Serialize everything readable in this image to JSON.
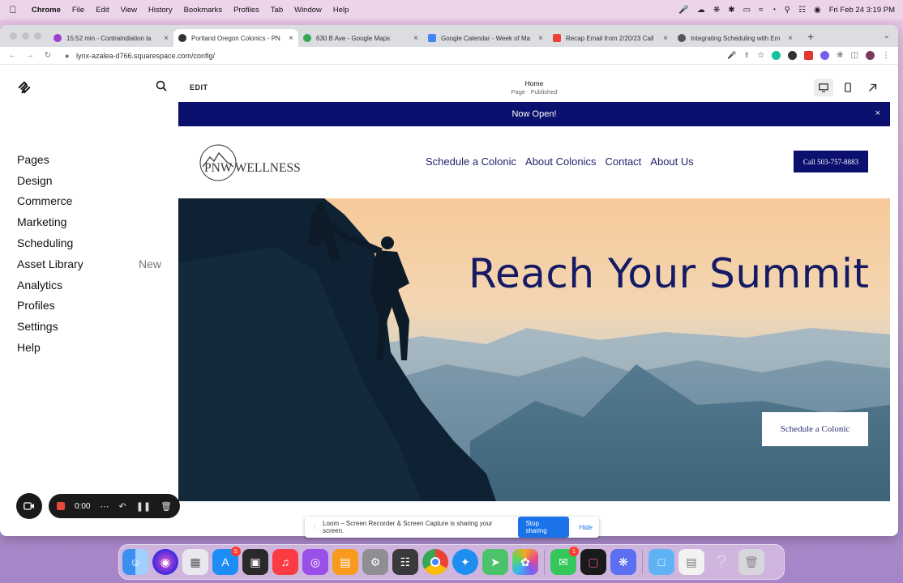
{
  "menubar": {
    "app": "Chrome",
    "items": [
      "File",
      "Edit",
      "View",
      "History",
      "Bookmarks",
      "Profiles",
      "Tab",
      "Window",
      "Help"
    ],
    "datetime": "Fri Feb 24  3:19 PM"
  },
  "browser": {
    "tabs": [
      {
        "title": "15:52 min - Contraindiation la",
        "favicon_color": "#9b3fd1"
      },
      {
        "title": "Portland Oregon Colonics - PN",
        "favicon_color": "#333333",
        "active": true
      },
      {
        "title": "630 B Ave - Google Maps",
        "favicon_color": "#34a853"
      },
      {
        "title": "Google Calendar - Week of Ma",
        "favicon_color": "#4285f4"
      },
      {
        "title": "Recap Email from 2/20/23 Call",
        "favicon_color": "#ea4335"
      },
      {
        "title": "Integrating Scheduling with Em",
        "favicon_color": "#555555"
      }
    ],
    "url": "lynx-azalea-d766.squarespace.com/config/"
  },
  "editor": {
    "nav": [
      {
        "label": "Pages"
      },
      {
        "label": "Design"
      },
      {
        "label": "Commerce"
      },
      {
        "label": "Marketing"
      },
      {
        "label": "Scheduling"
      },
      {
        "label": "Asset Library",
        "badge": "New"
      },
      {
        "label": "Analytics"
      },
      {
        "label": "Profiles"
      },
      {
        "label": "Settings"
      },
      {
        "label": "Help"
      }
    ],
    "edit_label": "EDIT",
    "page_name": "Home",
    "page_status": "Page · Published"
  },
  "loom": {
    "timer": "0:00",
    "share_message": "Loom – Screen Recorder & Screen Capture is sharing your screen.",
    "stop_label": "Stop sharing",
    "hide_label": "Hide"
  },
  "site": {
    "announcement": "Now Open!",
    "brand": "PNW WELLNESS",
    "nav": [
      "Schedule a Colonic",
      "About Colonics",
      "Contact",
      "About Us"
    ],
    "call_button": "Call 503-757-8883",
    "hero_title": "Reach Your Summit",
    "hero_cta": "Schedule a Colonic",
    "colors": {
      "navy": "#0b0f6d",
      "nav_text": "#21236b"
    }
  },
  "dock": {
    "apps": [
      {
        "name": "finder-icon",
        "color": "#3b8ff0"
      },
      {
        "name": "siri-icon",
        "color": "#6a3df0"
      },
      {
        "name": "launchpad-icon",
        "color": "#e8e8ee"
      },
      {
        "name": "app-store-icon",
        "color": "#1c8df5",
        "badge": "5"
      },
      {
        "name": "mission-control-icon",
        "color": "#2a2a2a"
      },
      {
        "name": "music-icon",
        "color": "#fc3c44"
      },
      {
        "name": "podcasts-icon",
        "color": "#9a4fe8"
      },
      {
        "name": "books-icon",
        "color": "#f79a1e"
      },
      {
        "name": "system-settings-icon",
        "color": "#8e8e93"
      },
      {
        "name": "calculator-icon",
        "color": "#3a3a3c"
      },
      {
        "name": "chrome-icon",
        "color": "#ffffff"
      },
      {
        "name": "safari-icon",
        "color": "#1e8ef0"
      },
      {
        "name": "maps-icon",
        "color": "#4cc36b"
      },
      {
        "name": "photos-icon",
        "color": "#f5f5f5"
      },
      {
        "name": "messages-icon",
        "color": "#34c759",
        "badge": "1"
      },
      {
        "name": "screen-recorder-icon",
        "color": "#1a1a1a"
      },
      {
        "name": "perplexity-icon",
        "color": "#5b6ff0"
      },
      {
        "name": "folder-icon",
        "color": "#5fb3f5"
      },
      {
        "name": "document-icon",
        "color": "#f2f2f2"
      },
      {
        "name": "help-icon",
        "color": "#d9d3e6"
      },
      {
        "name": "trash-icon",
        "color": "#d6d6dc"
      }
    ]
  }
}
